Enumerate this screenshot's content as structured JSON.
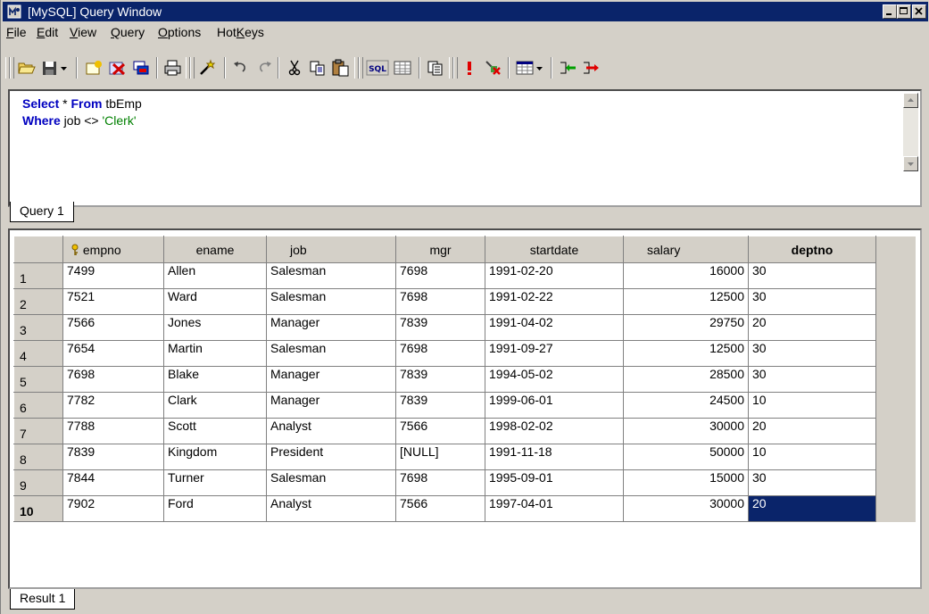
{
  "window": {
    "title": "[MySQL] Query Window"
  },
  "menu": [
    {
      "label": "File",
      "accel": "F"
    },
    {
      "label": "Edit",
      "accel": "E"
    },
    {
      "label": "View",
      "accel": "V"
    },
    {
      "label": "Query",
      "accel": "Q"
    },
    {
      "label": "Options",
      "accel": "O"
    },
    {
      "label": "HotKeys",
      "accel": "K"
    }
  ],
  "toolbar": {
    "icons": [
      "open-icon",
      "save-icon",
      "save-dropdown-icon",
      "new-query-icon",
      "delete-icon",
      "export-icon",
      "print-icon",
      "wizard-icon",
      "undo-icon",
      "redo-icon",
      "cut-icon",
      "copy-icon",
      "paste-icon",
      "sql-icon",
      "grid-icon",
      "copy-table-icon",
      "execute-icon",
      "stop-icon",
      "view-mode-icon",
      "view-dropdown-icon",
      "move-left-icon",
      "move-right-icon"
    ],
    "sql_label": "SQL"
  },
  "query": {
    "line1": {
      "kw1": "Select",
      "rest1": " * ",
      "kw2": "From",
      "rest2": " tbEmp"
    },
    "line2": {
      "kw1": "Where",
      "rest1": " job <> ",
      "str": "'Clerk'"
    },
    "tab": "Query 1"
  },
  "result": {
    "tab": "Result 1",
    "columns": [
      {
        "label": "empno",
        "key": true
      },
      {
        "label": "ename"
      },
      {
        "label": "job"
      },
      {
        "label": "mgr"
      },
      {
        "label": "startdate"
      },
      {
        "label": "salary"
      },
      {
        "label": "deptno",
        "active": true
      }
    ],
    "rows": [
      {
        "n": "1",
        "cells": [
          "7499",
          "Allen",
          "Salesman",
          "7698",
          "1991-02-20",
          "16000",
          "30"
        ]
      },
      {
        "n": "2",
        "cells": [
          "7521",
          "Ward",
          "Salesman",
          "7698",
          "1991-02-22",
          "12500",
          "30"
        ]
      },
      {
        "n": "3",
        "cells": [
          "7566",
          "Jones",
          "Manager",
          "7839",
          "1991-04-02",
          "29750",
          "20"
        ]
      },
      {
        "n": "4",
        "cells": [
          "7654",
          "Martin",
          "Salesman",
          "7698",
          "1991-09-27",
          "12500",
          "30"
        ]
      },
      {
        "n": "5",
        "cells": [
          "7698",
          "Blake",
          "Manager",
          "7839",
          "1994-05-02",
          "28500",
          "30"
        ]
      },
      {
        "n": "6",
        "cells": [
          "7782",
          "Clark",
          "Manager",
          "7839",
          "1999-06-01",
          "24500",
          "10"
        ]
      },
      {
        "n": "7",
        "cells": [
          "7788",
          "Scott",
          "Analyst",
          "7566",
          "1998-02-02",
          "30000",
          "20"
        ]
      },
      {
        "n": "8",
        "cells": [
          "7839",
          "Kingdom",
          "President",
          "[NULL]",
          "1991-11-18",
          "50000",
          "10"
        ]
      },
      {
        "n": "9",
        "cells": [
          "7844",
          "Turner",
          "Salesman",
          "7698",
          "1995-09-01",
          "15000",
          "30"
        ]
      },
      {
        "n": "10",
        "cells": [
          "7902",
          "Ford",
          "Analyst",
          "7566",
          "1997-04-01",
          "30000",
          "20"
        ]
      }
    ],
    "current_row": "10"
  }
}
